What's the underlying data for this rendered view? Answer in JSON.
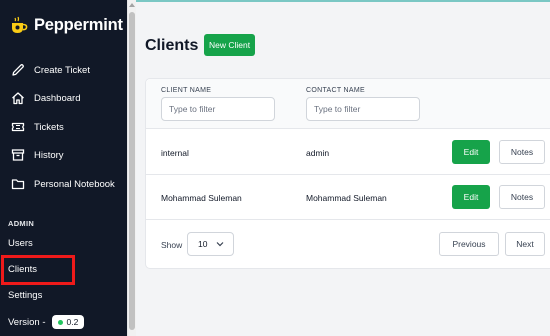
{
  "app": {
    "name": "Peppermint"
  },
  "sidebar": {
    "items": [
      {
        "label": "Create Ticket",
        "icon": "pencil-icon"
      },
      {
        "label": "Dashboard",
        "icon": "home-icon"
      },
      {
        "label": "Tickets",
        "icon": "ticket-icon"
      },
      {
        "label": "History",
        "icon": "archive-icon"
      },
      {
        "label": "Personal Notebook",
        "icon": "folder-icon"
      }
    ],
    "admin_heading": "ADMIN",
    "admin_links": [
      "Users",
      "Clients",
      "Settings"
    ],
    "version_label": "Version -",
    "version_value": "0.2"
  },
  "page": {
    "title": "Clients",
    "new_client_label": "New Client"
  },
  "table": {
    "columns": [
      "CLIENT NAME",
      "CONTACT NAME"
    ],
    "filter_placeholder": "Type to filter",
    "rows": [
      {
        "client": "internal",
        "contact": "admin"
      },
      {
        "client": "Mohammad Suleman",
        "contact": "Mohammad Suleman"
      }
    ],
    "edit_label": "Edit",
    "notes_label": "Notes"
  },
  "pagination": {
    "show_label": "Show",
    "page_size": "10",
    "previous_label": "Previous",
    "next_label": "Next"
  },
  "colors": {
    "sidebar_bg": "#111827",
    "accent_green": "#16a34a",
    "highlight_red": "#ef1a1a",
    "brand_cup": "#facc15"
  }
}
